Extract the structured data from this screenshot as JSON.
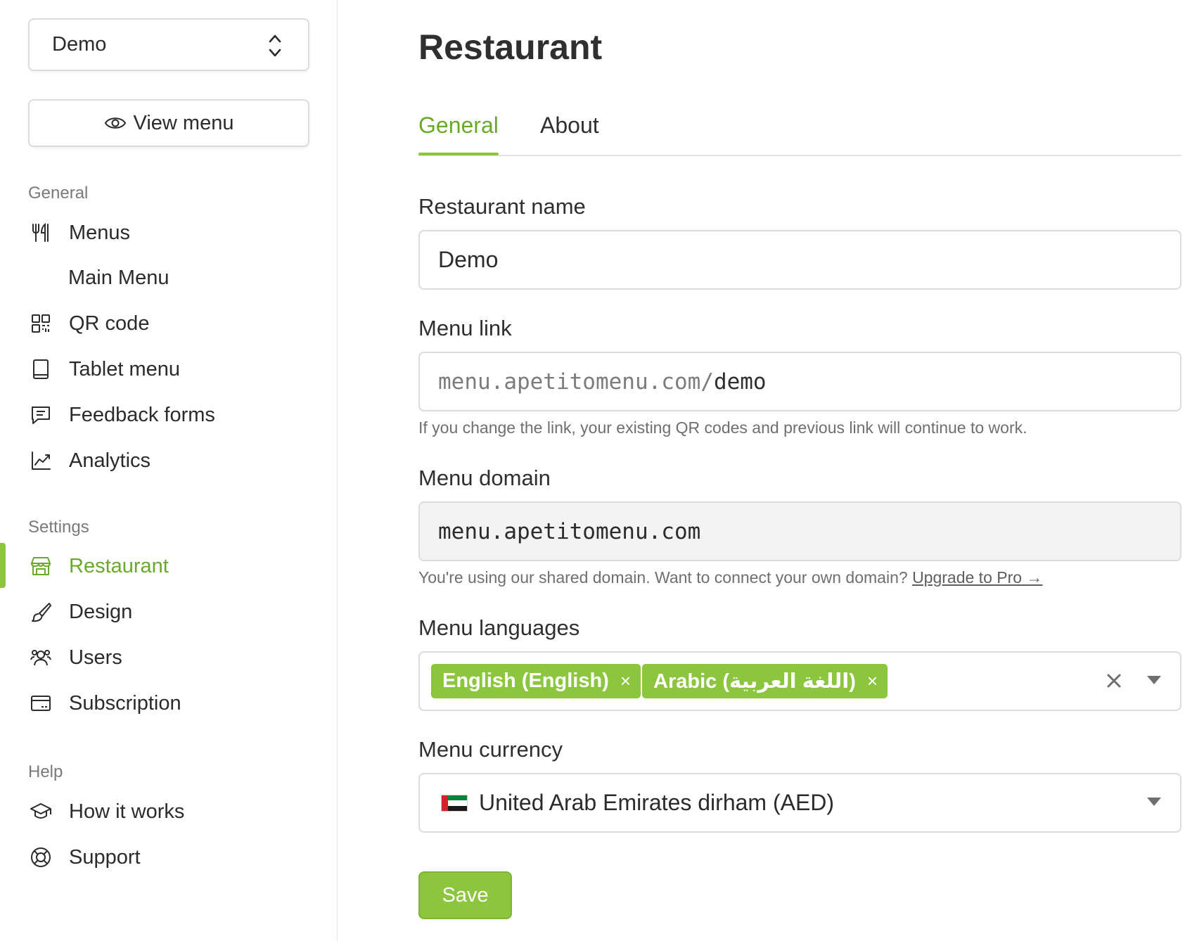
{
  "sidebar": {
    "workspace_select": "Demo",
    "view_menu": "View menu",
    "sections": {
      "general": "General",
      "settings": "Settings",
      "help": "Help"
    },
    "items": {
      "menus": "Menus",
      "main_menu": "Main Menu",
      "qr_code": "QR code",
      "tablet_menu": "Tablet menu",
      "feedback_forms": "Feedback forms",
      "analytics": "Analytics",
      "restaurant": "Restaurant",
      "design": "Design",
      "users": "Users",
      "subscription": "Subscription",
      "how_it_works": "How it works",
      "support": "Support"
    },
    "active_item": "Restaurant"
  },
  "main": {
    "title": "Restaurant",
    "tabs": [
      "General",
      "About"
    ],
    "active_tab": "General",
    "restaurant_name": {
      "label": "Restaurant name",
      "value": "Demo"
    },
    "menu_link": {
      "label": "Menu link",
      "prefix": "menu.apetitomenu.com/",
      "value": "demo",
      "help": "If you change the link, your existing QR codes and previous link will continue to work."
    },
    "menu_domain": {
      "label": "Menu domain",
      "value": "menu.apetitomenu.com",
      "help": "You're using our shared domain. Want to connect your own domain?",
      "help_link": "Upgrade to Pro →"
    },
    "menu_languages": {
      "label": "Menu languages",
      "tags": [
        "English (English)",
        "Arabic (اللغة العربية)"
      ],
      "remove_symbol": "×"
    },
    "menu_currency": {
      "label": "Menu currency",
      "value": "United Arab Emirates dirham (AED)",
      "flag_icon": "uae-flag-icon"
    },
    "save_label": "Save"
  },
  "colors": {
    "accent": "#8cc63f",
    "accent_text": "#6aaa2b",
    "border": "#dcdcdc"
  }
}
